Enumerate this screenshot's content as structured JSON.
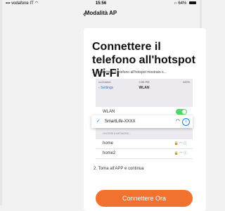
{
  "status_bar": {
    "carrier": "vodafone IT",
    "time": "15:56",
    "battery": "64%"
  },
  "nav": {
    "back_glyph": "‹",
    "title": "Modalità AP"
  },
  "content": {
    "heading": "Connettere il telefono all'hotspot Wi-Fi",
    "step1": "1. Connettere il telefono all'hotspot mostrato s...",
    "step2": "2. Torna all'APP e continua"
  },
  "illustration": {
    "status_left": "••••Carrier",
    "status_time": "2:56 PM",
    "status_right": "100%",
    "back_label": "Settings",
    "screen_title": "WLAN",
    "wlan_label": "WLAN",
    "section_label": "CHOOSE A NETWORK...",
    "networks": [
      "home",
      "home2"
    ],
    "selected_network": "SmartLife-XXXX"
  },
  "cta": {
    "label": "Connettere Ora"
  },
  "colors": {
    "accent": "#f0722e",
    "ios_blue": "#1a7ef0",
    "toggle_green": "#4cd964"
  }
}
